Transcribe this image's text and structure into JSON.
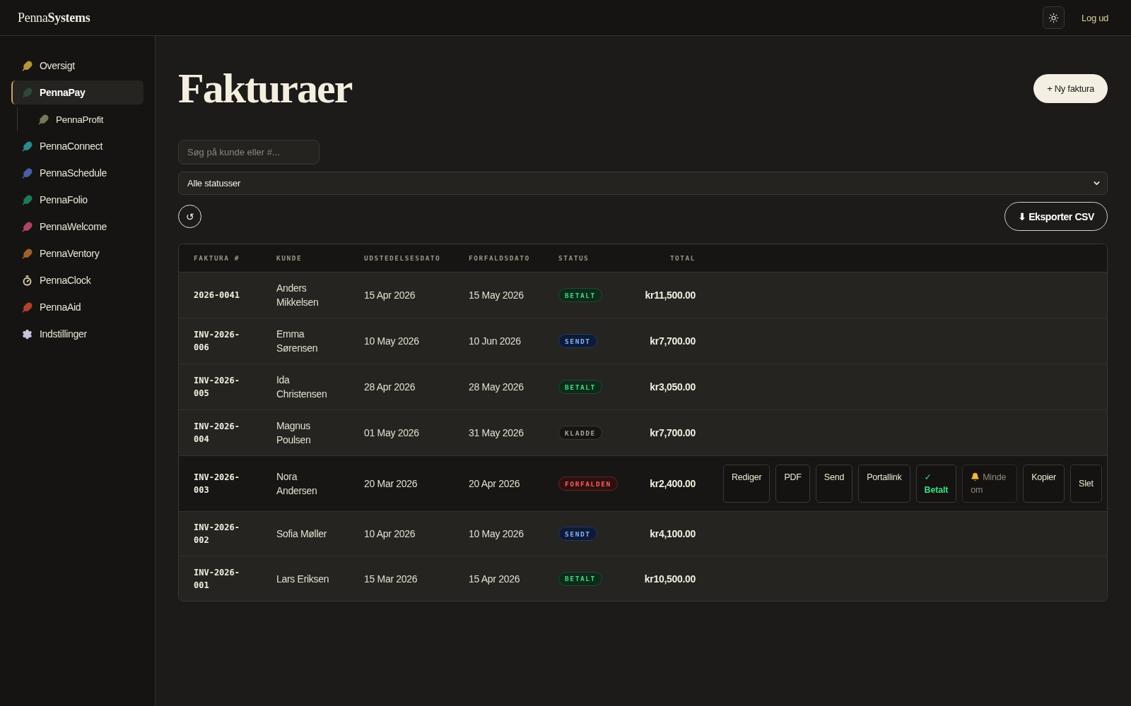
{
  "topbar": {
    "logo": "Penna**Systems**",
    "logout": "Log ud"
  },
  "sidebar": {
    "items": [
      {
        "label": "Oversigt",
        "kind": "feather",
        "color": "#b8953a",
        "selected": false
      },
      {
        "label": "PennaPay",
        "kind": "feather",
        "color": "#2f4a3c",
        "selected": true,
        "children": [
          {
            "label": "PennaProfit",
            "kind": "feather",
            "color": "#77775a",
            "selected": false
          }
        ]
      },
      {
        "label": "PennaConnect",
        "kind": "feather",
        "color": "#2a8a8f",
        "selected": false
      },
      {
        "label": "PennaSchedule",
        "kind": "feather",
        "color": "#4a5fa8",
        "selected": false
      },
      {
        "label": "PennaFolio",
        "kind": "feather",
        "color": "#1f7a5c",
        "selected": false
      },
      {
        "label": "PennaWelcome",
        "kind": "feather",
        "color": "#b0446a",
        "selected": false
      },
      {
        "label": "PennaVentory",
        "kind": "feather",
        "color": "#a0622a",
        "selected": false
      },
      {
        "label": "PennaClock",
        "kind": "stopwatch",
        "color": "#d8d0b0",
        "selected": false
      },
      {
        "label": "PennaAid",
        "kind": "feather",
        "color": "#b3402f",
        "selected": false
      },
      {
        "label": "Indstillinger",
        "kind": "gear",
        "color": "#c8c4dc",
        "selected": false
      }
    ]
  },
  "page": {
    "title": "Fakturaer",
    "new_button": "+ Ny faktura"
  },
  "filters": {
    "search": {
      "placeholder": "Søg på kunde eller #..."
    },
    "status_select": {
      "value": "Alle statusser"
    },
    "refresh_button": "↺",
    "export_button": "⬇ Eksporter CSV"
  },
  "table": {
    "columns": [
      "FAKTURA #",
      "KUNDE",
      "UDSTEDELSESDATO",
      "FORFALDSDATO",
      "STATUS",
      "TOTAL"
    ],
    "rows": [
      {
        "number": "2026-0041",
        "customer": "Anders Mikkelsen",
        "issued": "15 Apr 2026",
        "due": "15 May 2026",
        "status": {
          "label": "BETALT",
          "kind": "paid"
        },
        "total": "kr11,500.00",
        "selected": false
      },
      {
        "number": "INV-2026-006",
        "customer": "Emma Sørensen",
        "issued": "10 May 2026",
        "due": "10 Jun 2026",
        "status": {
          "label": "SENDT",
          "kind": "sent"
        },
        "total": "kr7,700.00",
        "selected": false
      },
      {
        "number": "INV-2026-005",
        "customer": "Ida Christensen",
        "issued": "28 Apr 2026",
        "due": "28 May 2026",
        "status": {
          "label": "BETALT",
          "kind": "paid"
        },
        "total": "kr3,050.00",
        "selected": false
      },
      {
        "number": "INV-2026-004",
        "customer": "Magnus Poulsen",
        "issued": "01 May 2026",
        "due": "31 May 2026",
        "status": {
          "label": "KLADDE",
          "kind": "draft"
        },
        "total": "kr7,700.00",
        "selected": false
      },
      {
        "number": "INV-2026-003",
        "customer": "Nora Andersen",
        "issued": "20 Mar 2026",
        "due": "20 Apr 2026",
        "status": {
          "label": "FORFALDEN",
          "kind": "overdue"
        },
        "total": "kr2,400.00",
        "selected": true,
        "actions": [
          {
            "label": "Rediger",
            "kind": "link",
            "disabled": false
          },
          {
            "label": "PDF",
            "kind": "link",
            "disabled": false
          },
          {
            "label": "Send",
            "kind": "link",
            "disabled": false
          },
          {
            "label": "Portallink",
            "kind": "link",
            "disabled": false
          },
          {
            "label": "✓ Betalt",
            "kind": "paid",
            "disabled": false
          },
          {
            "label": "Minde om",
            "kind": "reminder",
            "disabled": true
          },
          {
            "label": "Kopier",
            "kind": "link",
            "disabled": false
          },
          {
            "label": "Slet",
            "kind": "button",
            "disabled": false
          }
        ]
      },
      {
        "number": "INV-2026-002",
        "customer": "Sofia Møller",
        "issued": "10 Apr 2026",
        "due": "10 May 2026",
        "status": {
          "label": "SENDT",
          "kind": "sent"
        },
        "total": "kr4,100.00",
        "selected": false
      },
      {
        "number": "INV-2026-001",
        "customer": "Lars Eriksen",
        "issued": "15 Mar 2026",
        "due": "15 Apr 2026",
        "status": {
          "label": "BETALT",
          "kind": "paid"
        },
        "total": "kr10,500.00",
        "selected": false
      }
    ]
  }
}
